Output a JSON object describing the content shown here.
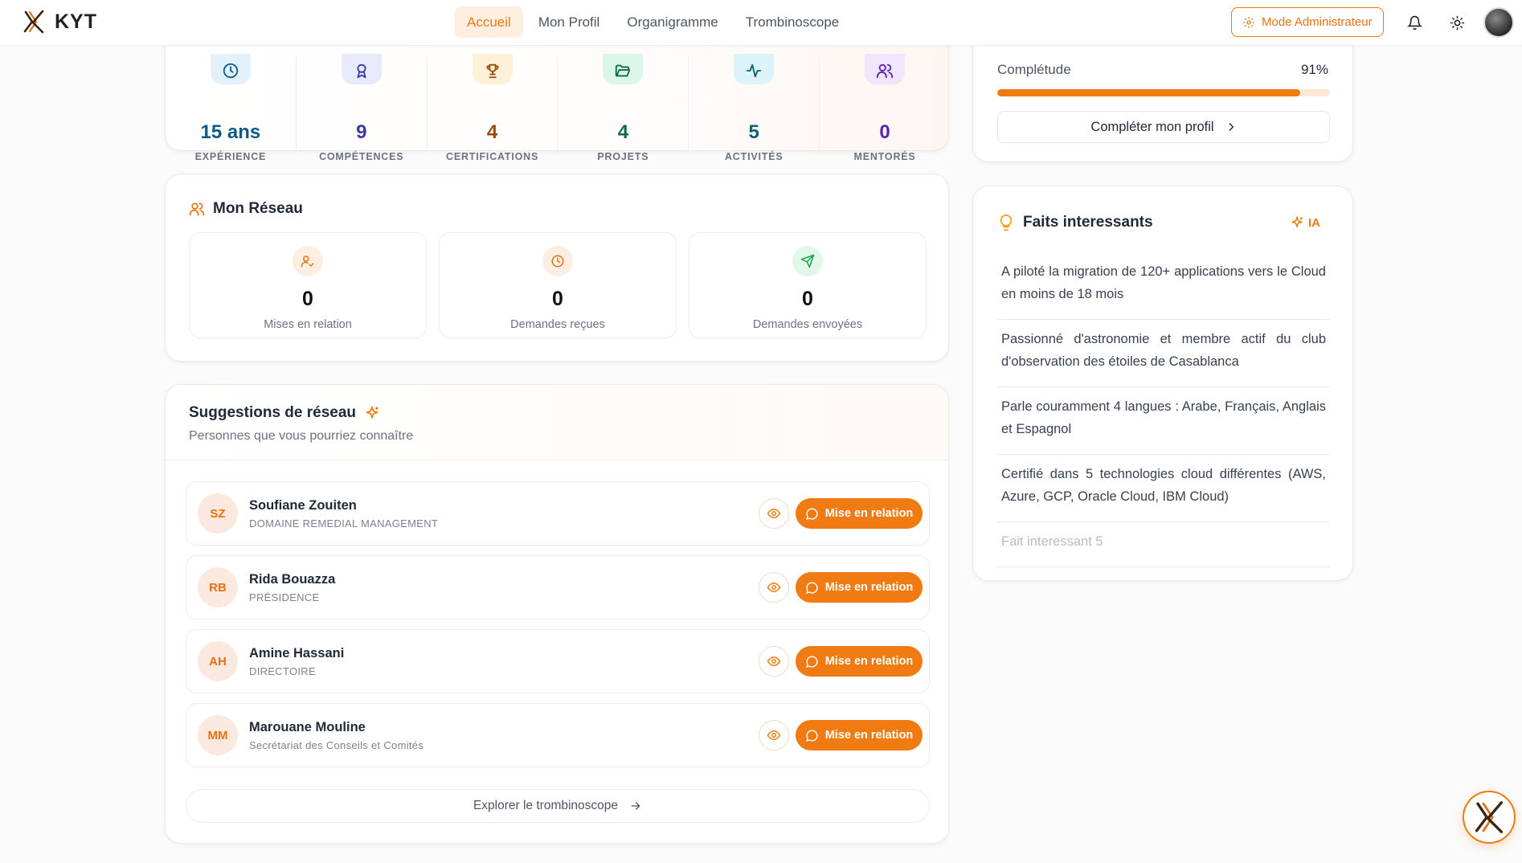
{
  "brand": {
    "name": "KYT"
  },
  "nav": [
    {
      "label": "Accueil",
      "active": true
    },
    {
      "label": "Mon Profil",
      "active": false
    },
    {
      "label": "Organigramme",
      "active": false
    },
    {
      "label": "Trombinoscope",
      "active": false
    }
  ],
  "header": {
    "admin_label": "Mode Administrateur",
    "icons": [
      "bell-icon",
      "sun-icon",
      "user-avatar"
    ]
  },
  "colors": {
    "accent": "#f07b12",
    "accent_soft": "#fdeee0"
  },
  "stats": [
    {
      "value": "15 ans",
      "label": "EXPÉRIENCE",
      "icon": "clock-icon",
      "color": "#0c5a8a",
      "bg": "#e2f1fb"
    },
    {
      "value": "9",
      "label": "COMPÉTENCES",
      "icon": "award-icon",
      "color": "#3b3aa8",
      "bg": "#e8e9fb"
    },
    {
      "value": "4",
      "label": "CERTIFICATIONS",
      "icon": "trophy-icon",
      "color": "#9a4a0e",
      "bg": "#fdf1d8"
    },
    {
      "value": "4",
      "label": "PROJETS",
      "icon": "folder-open-icon",
      "color": "#0f6a46",
      "bg": "#dcf6ea"
    },
    {
      "value": "5",
      "label": "ACTIVITÉS",
      "icon": "activity-icon",
      "color": "#0e6078",
      "bg": "#dcf4f9"
    },
    {
      "value": "0",
      "label": "MENTORÉS",
      "icon": "users-icon",
      "color": "#5b21b6",
      "bg": "#efe6fd"
    }
  ],
  "reseau": {
    "title": "Mon Réseau",
    "boxes": [
      {
        "value": "0",
        "label": "Mises en relation",
        "icon": "user-check-icon",
        "color": "#e8700c",
        "bg": "#fdeee2"
      },
      {
        "value": "0",
        "label": "Demandes reçues",
        "icon": "clock-icon",
        "color": "#e8700c",
        "bg": "#fdeee2"
      },
      {
        "value": "0",
        "label": "Demandes envoyées",
        "icon": "send-icon",
        "color": "#16a34a",
        "bg": "#e1f7e9"
      }
    ]
  },
  "suggestions": {
    "title": "Suggestions de réseau",
    "subtitle": "Personnes que vous pourriez connaître",
    "connect_label": "Mise en relation",
    "explore_label": "Explorer le trombinoscope",
    "people": [
      {
        "initials": "SZ",
        "name": "Soufiane Zouiten",
        "dept": "DOMAINE REMEDIAL MANAGEMENT"
      },
      {
        "initials": "RB",
        "name": "Rida Bouazza",
        "dept": "PRÉSIDENCE"
      },
      {
        "initials": "AH",
        "name": "Amine Hassani",
        "dept": "DIRECTOIRE"
      },
      {
        "initials": "MM",
        "name": "Marouane Mouline",
        "dept": "Secrétariat des Conseils et Comités"
      }
    ]
  },
  "profile": {
    "completion_label": "Complétude",
    "completion_value": "91%",
    "completion_fraction": 0.91,
    "complete_button": "Compléter mon profil"
  },
  "facts": {
    "title": "Faits interessants",
    "badge": "IA",
    "items": [
      "A piloté la migration de 120+ applications vers le Cloud en moins de 18 mois",
      "Passionné d'astronomie et membre actif du club d'observation des étoiles de Casablanca",
      "Parle couramment 4 langues : Arabe, Français, Anglais et Espagnol",
      "Certifié dans 5 technologies cloud différentes (AWS, Azure, GCP, Oracle Cloud, IBM Cloud)",
      "Fait interessant 5"
    ]
  }
}
